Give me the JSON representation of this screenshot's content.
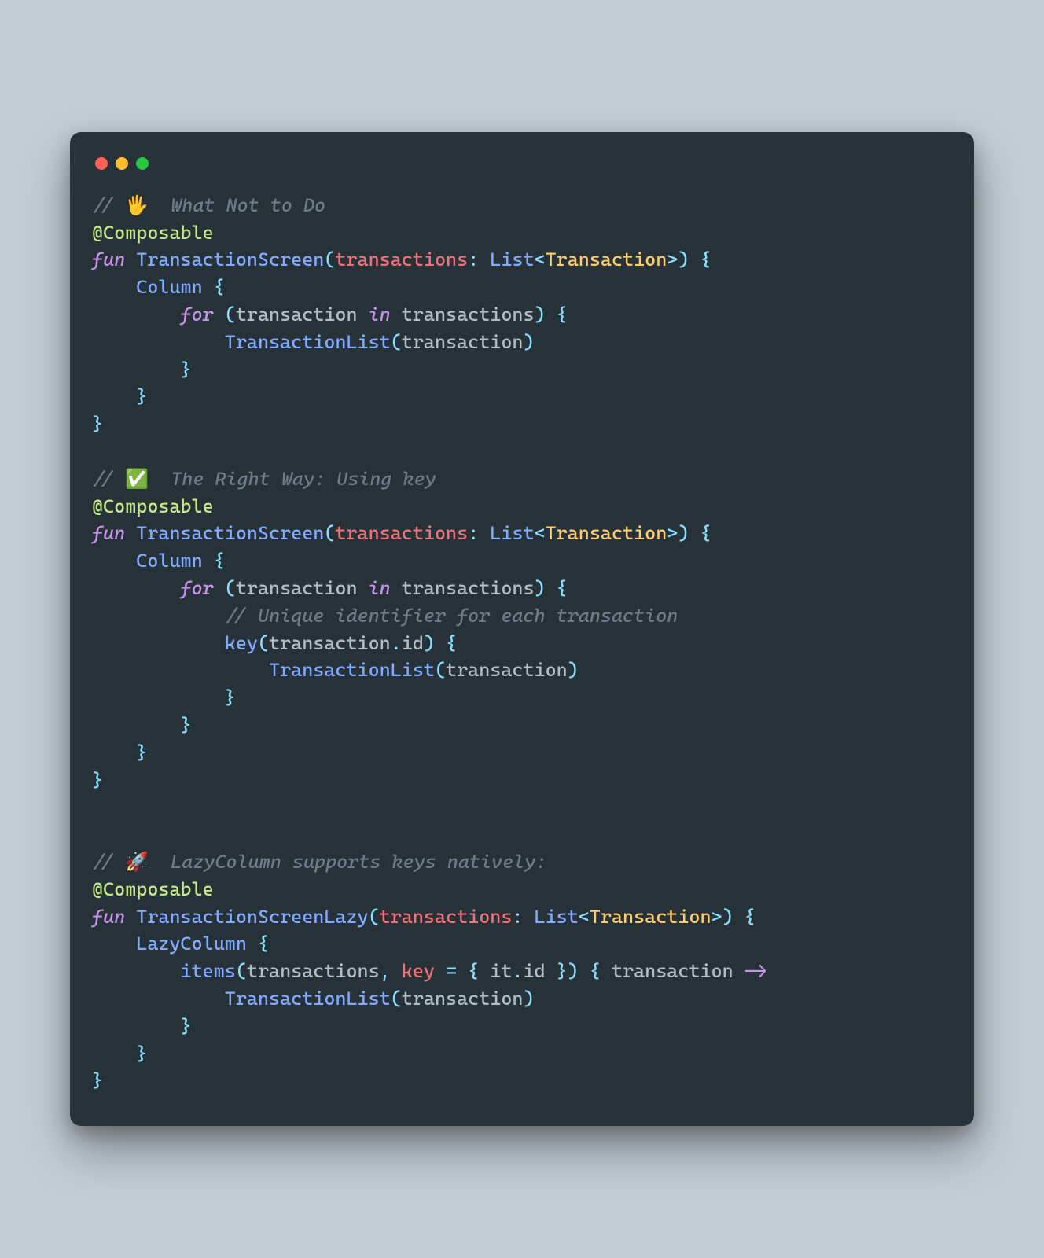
{
  "window": {
    "traffic_lights": [
      "red",
      "yellow",
      "green"
    ]
  },
  "colors": {
    "background_page": "#c3cdd6",
    "background_window": "#263238",
    "comment": "#6c7d89",
    "annotation": "#c3e88d",
    "keyword": "#c792ea",
    "function": "#82aaff",
    "param": "#f07178",
    "type_arg": "#ffcb6b",
    "punct": "#89ddff",
    "traffic_red": "#ff5f56",
    "traffic_yellow": "#ffbd2e",
    "traffic_green": "#27c93f"
  },
  "code": {
    "language": "kotlin",
    "lines": [
      [
        [
          "comment",
          "// "
        ],
        [
          "emoji",
          "🖐"
        ],
        [
          "comment",
          "  What Not to Do"
        ]
      ],
      [
        [
          "annot",
          "@Composable"
        ]
      ],
      [
        [
          "keyword",
          "fun"
        ],
        [
          "plain",
          " "
        ],
        [
          "fnname",
          "TransactionScreen"
        ],
        [
          "punct",
          "("
        ],
        [
          "param",
          "transactions"
        ],
        [
          "punct",
          ":"
        ],
        [
          "plain",
          " "
        ],
        [
          "type",
          "List"
        ],
        [
          "punct",
          "<"
        ],
        [
          "typearg",
          "Transaction"
        ],
        [
          "punct",
          ">"
        ],
        [
          "punct",
          ")"
        ],
        [
          "plain",
          " "
        ],
        [
          "punct",
          "{"
        ]
      ],
      [
        [
          "plain",
          "    "
        ],
        [
          "call",
          "Column"
        ],
        [
          "plain",
          " "
        ],
        [
          "punct",
          "{"
        ]
      ],
      [
        [
          "plain",
          "        "
        ],
        [
          "keyword",
          "for"
        ],
        [
          "plain",
          " "
        ],
        [
          "punct",
          "("
        ],
        [
          "ident",
          "transaction"
        ],
        [
          "plain",
          " "
        ],
        [
          "keyword",
          "in"
        ],
        [
          "plain",
          " "
        ],
        [
          "ident",
          "transactions"
        ],
        [
          "punct",
          ")"
        ],
        [
          "plain",
          " "
        ],
        [
          "punct",
          "{"
        ]
      ],
      [
        [
          "plain",
          "            "
        ],
        [
          "call",
          "TransactionList"
        ],
        [
          "punct",
          "("
        ],
        [
          "ident",
          "transaction"
        ],
        [
          "punct",
          ")"
        ]
      ],
      [
        [
          "plain",
          "        "
        ],
        [
          "punct",
          "}"
        ]
      ],
      [
        [
          "plain",
          "    "
        ],
        [
          "punct",
          "}"
        ]
      ],
      [
        [
          "punct",
          "}"
        ]
      ],
      [],
      [
        [
          "comment",
          "// "
        ],
        [
          "emoji",
          "✅"
        ],
        [
          "comment",
          "  The Right Way: Using key"
        ]
      ],
      [
        [
          "annot",
          "@Composable"
        ]
      ],
      [
        [
          "keyword",
          "fun"
        ],
        [
          "plain",
          " "
        ],
        [
          "fnname",
          "TransactionScreen"
        ],
        [
          "punct",
          "("
        ],
        [
          "param",
          "transactions"
        ],
        [
          "punct",
          ":"
        ],
        [
          "plain",
          " "
        ],
        [
          "type",
          "List"
        ],
        [
          "punct",
          "<"
        ],
        [
          "typearg",
          "Transaction"
        ],
        [
          "punct",
          ">"
        ],
        [
          "punct",
          ")"
        ],
        [
          "plain",
          " "
        ],
        [
          "punct",
          "{"
        ]
      ],
      [
        [
          "plain",
          "    "
        ],
        [
          "call",
          "Column"
        ],
        [
          "plain",
          " "
        ],
        [
          "punct",
          "{"
        ]
      ],
      [
        [
          "plain",
          "        "
        ],
        [
          "keyword",
          "for"
        ],
        [
          "plain",
          " "
        ],
        [
          "punct",
          "("
        ],
        [
          "ident",
          "transaction"
        ],
        [
          "plain",
          " "
        ],
        [
          "keyword",
          "in"
        ],
        [
          "plain",
          " "
        ],
        [
          "ident",
          "transactions"
        ],
        [
          "punct",
          ")"
        ],
        [
          "plain",
          " "
        ],
        [
          "punct",
          "{"
        ]
      ],
      [
        [
          "plain",
          "            "
        ],
        [
          "comment",
          "// Unique identifier for each transaction"
        ]
      ],
      [
        [
          "plain",
          "            "
        ],
        [
          "call",
          "key"
        ],
        [
          "punct",
          "("
        ],
        [
          "ident",
          "transaction"
        ],
        [
          "op",
          "."
        ],
        [
          "prop",
          "id"
        ],
        [
          "punct",
          ")"
        ],
        [
          "plain",
          " "
        ],
        [
          "punct",
          "{"
        ]
      ],
      [
        [
          "plain",
          "                "
        ],
        [
          "call",
          "TransactionList"
        ],
        [
          "punct",
          "("
        ],
        [
          "ident",
          "transaction"
        ],
        [
          "punct",
          ")"
        ]
      ],
      [
        [
          "plain",
          "            "
        ],
        [
          "punct",
          "}"
        ]
      ],
      [
        [
          "plain",
          "        "
        ],
        [
          "punct",
          "}"
        ]
      ],
      [
        [
          "plain",
          "    "
        ],
        [
          "punct",
          "}"
        ]
      ],
      [
        [
          "punct",
          "}"
        ]
      ],
      [],
      [],
      [
        [
          "comment",
          "// "
        ],
        [
          "emoji",
          "🚀"
        ],
        [
          "comment",
          "  LazyColumn supports keys natively:"
        ]
      ],
      [
        [
          "annot",
          "@Composable"
        ]
      ],
      [
        [
          "keyword",
          "fun"
        ],
        [
          "plain",
          " "
        ],
        [
          "fnname",
          "TransactionScreenLazy"
        ],
        [
          "punct",
          "("
        ],
        [
          "param",
          "transactions"
        ],
        [
          "punct",
          ":"
        ],
        [
          "plain",
          " "
        ],
        [
          "type",
          "List"
        ],
        [
          "punct",
          "<"
        ],
        [
          "typearg",
          "Transaction"
        ],
        [
          "punct",
          ">"
        ],
        [
          "punct",
          ")"
        ],
        [
          "plain",
          " "
        ],
        [
          "punct",
          "{"
        ]
      ],
      [
        [
          "plain",
          "    "
        ],
        [
          "call",
          "LazyColumn"
        ],
        [
          "plain",
          " "
        ],
        [
          "punct",
          "{"
        ]
      ],
      [
        [
          "plain",
          "        "
        ],
        [
          "call",
          "items"
        ],
        [
          "punct",
          "("
        ],
        [
          "ident",
          "transactions"
        ],
        [
          "op",
          ","
        ],
        [
          "plain",
          " "
        ],
        [
          "param",
          "key"
        ],
        [
          "plain",
          " "
        ],
        [
          "op",
          "="
        ],
        [
          "plain",
          " "
        ],
        [
          "punct",
          "{"
        ],
        [
          "plain",
          " "
        ],
        [
          "ident",
          "it"
        ],
        [
          "op",
          "."
        ],
        [
          "prop",
          "id"
        ],
        [
          "plain",
          " "
        ],
        [
          "punct",
          "}"
        ],
        [
          "punct",
          ")"
        ],
        [
          "plain",
          " "
        ],
        [
          "punct",
          "{"
        ],
        [
          "plain",
          " "
        ],
        [
          "ident",
          "transaction"
        ],
        [
          "plain",
          " "
        ],
        [
          "arrow",
          "->"
        ]
      ],
      [
        [
          "plain",
          "            "
        ],
        [
          "call",
          "TransactionList"
        ],
        [
          "punct",
          "("
        ],
        [
          "ident",
          "transaction"
        ],
        [
          "punct",
          ")"
        ]
      ],
      [
        [
          "plain",
          "        "
        ],
        [
          "punct",
          "}"
        ]
      ],
      [
        [
          "plain",
          "    "
        ],
        [
          "punct",
          "}"
        ]
      ],
      [
        [
          "punct",
          "}"
        ]
      ]
    ]
  }
}
